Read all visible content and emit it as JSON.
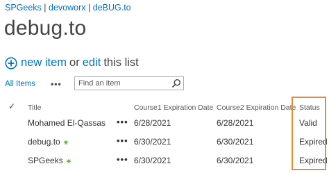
{
  "breadcrumb": {
    "items": [
      "SPGeeks",
      "devoworx",
      "deBUG.to"
    ],
    "separator": "|"
  },
  "page": {
    "title": "debug.to"
  },
  "actions": {
    "new_item_label": "new item",
    "or_label": "or",
    "edit_label": "edit",
    "this_list_label": "this list"
  },
  "view": {
    "current_view": "All Items",
    "more_label": "•••"
  },
  "search": {
    "placeholder": "Find an item"
  },
  "table": {
    "columns": [
      "Title",
      "Course1 Expiration Date",
      "Course2 Expiration Date",
      "Status"
    ],
    "check_glyph": "✓",
    "row_menu_label": "•••",
    "rows": [
      {
        "title": "Mohamed El-Qassas",
        "course1": "6/28/2021",
        "course2": "6/28/2021",
        "status": "Valid",
        "new": false
      },
      {
        "title": "debug.to",
        "course1": "6/30/2021",
        "course2": "6/30/2021",
        "status": "Expired",
        "new": true
      },
      {
        "title": "SPGeeks",
        "course1": "6/30/2021",
        "course2": "6/30/2021",
        "status": "Expired",
        "new": true
      }
    ]
  },
  "colors": {
    "link": "#0072c6",
    "highlight_border": "#ee8a2c",
    "new_icon": "#6fb43f"
  },
  "icons": {
    "add": "add-circle-icon",
    "search": "search-icon",
    "new_item": "new-item-icon"
  }
}
